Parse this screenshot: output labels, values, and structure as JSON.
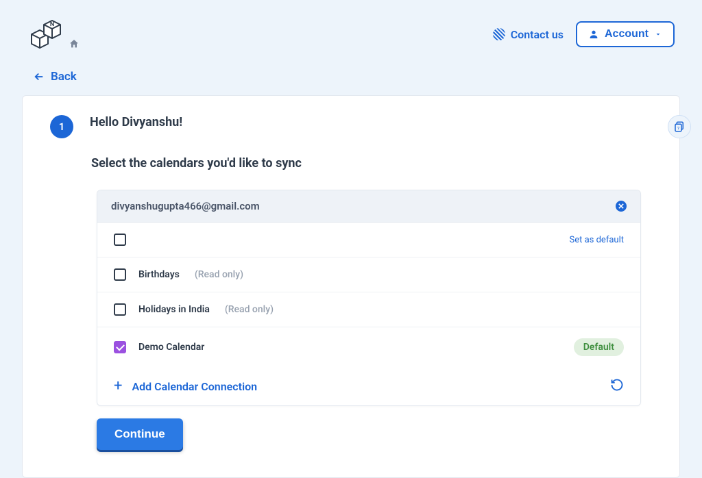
{
  "header": {
    "contact_label": "Contact us",
    "account_label": "Account"
  },
  "nav": {
    "back_label": "Back"
  },
  "step": {
    "number": "1",
    "greeting": "Hello Divyanshu!",
    "subtitle": "Select the calendars you'd like to sync"
  },
  "connection": {
    "email": "divyanshugupta466@gmail.com",
    "set_default_label": "Set as default",
    "default_badge": "Default",
    "add_label": "Add Calendar Connection",
    "readonly_suffix": "(Read only)",
    "calendars": [
      {
        "name": "",
        "readonly": false,
        "checked": false,
        "show_set_default": true,
        "is_default": false
      },
      {
        "name": "Birthdays",
        "readonly": true,
        "checked": false,
        "show_set_default": false,
        "is_default": false
      },
      {
        "name": "Holidays in India",
        "readonly": true,
        "checked": false,
        "show_set_default": false,
        "is_default": false
      },
      {
        "name": "Demo Calendar",
        "readonly": false,
        "checked": true,
        "show_set_default": false,
        "is_default": true
      }
    ]
  },
  "actions": {
    "continue_label": "Continue"
  }
}
